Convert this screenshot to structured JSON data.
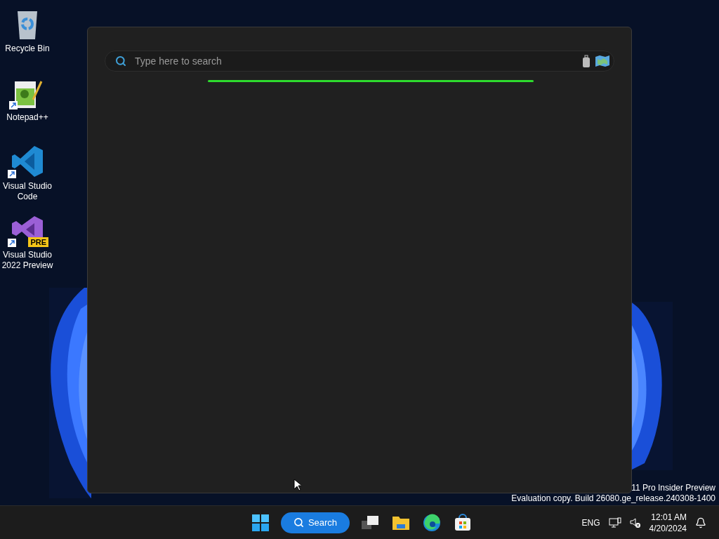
{
  "desktop_icons": [
    {
      "kind": "recycle",
      "label": "Recycle Bin"
    },
    {
      "kind": "notepad",
      "label": "Notepad++"
    },
    {
      "kind": "vscode",
      "label": "Visual Studio Code"
    },
    {
      "kind": "vs",
      "label": "Visual Studio 2022 Preview",
      "badge": "PRE"
    }
  ],
  "search_window": {
    "placeholder": "Type here to search"
  },
  "watermark": [
    "11 Pro Insider Preview",
    "Evaluation copy. Build 26080.ge_release.240308-1400"
  ],
  "taskbar": {
    "search_label": "Search",
    "apps": [
      {
        "kind": "task-view"
      },
      {
        "kind": "explorer"
      },
      {
        "kind": "edge"
      },
      {
        "kind": "store"
      }
    ],
    "language": "ENG",
    "time": "12:01 AM",
    "date": "4/20/2024"
  }
}
